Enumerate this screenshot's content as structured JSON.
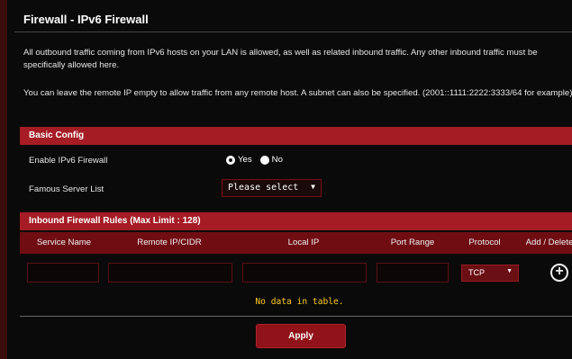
{
  "page": {
    "title": "Firewall - IPv6 Firewall",
    "description1": "All outbound traffic coming from IPv6 hosts on your LAN is allowed, as well as related inbound traffic. Any other inbound traffic must be specifically allowed here.",
    "description2": "You can leave the remote IP empty to allow traffic from any remote host. A subnet can also be specified. (2001::1111:2222:3333/64 for example)"
  },
  "basic_config": {
    "header": "Basic Config",
    "enable_label": "Enable IPv6 Firewall",
    "yes_label": "Yes",
    "no_label": "No",
    "selected": "Yes",
    "server_list_label": "Famous Server List",
    "server_list_value": "Please select",
    "arrow": "▼"
  },
  "inbound": {
    "header": "Inbound Firewall Rules (Max Limit : 128)",
    "columns": [
      "Service Name",
      "Remote IP/CIDR",
      "Local IP",
      "Port Range",
      "Protocol",
      "Add / Delete"
    ],
    "protocol_value": "TCP",
    "arrow": "▼",
    "add_symbol": "+",
    "empty_text": "No data in table."
  },
  "actions": {
    "apply_label": "Apply"
  }
}
